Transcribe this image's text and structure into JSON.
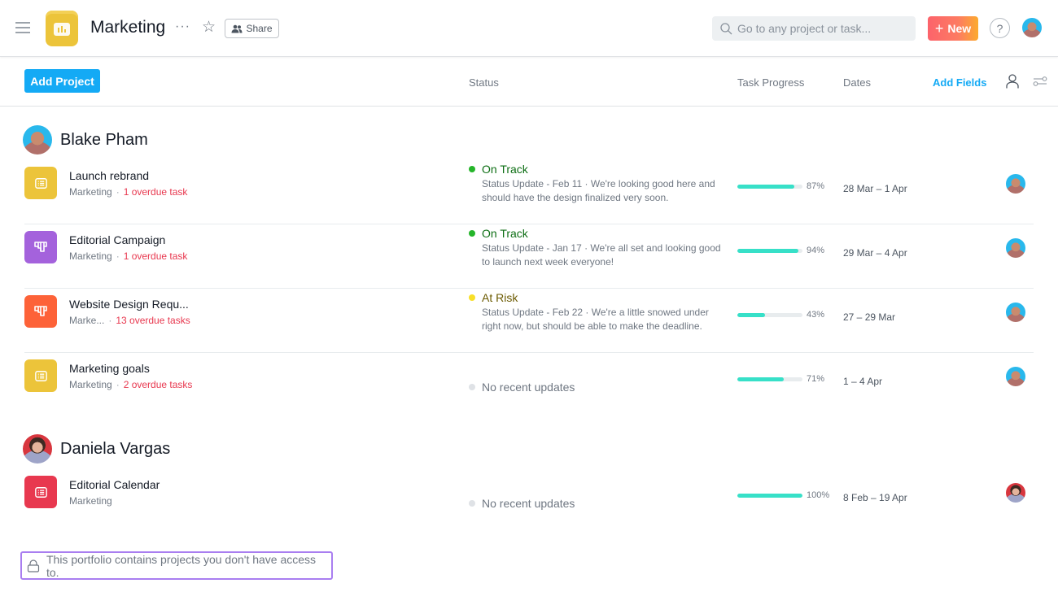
{
  "header": {
    "title": "Marketing",
    "more_label": "···",
    "share_label": "Share",
    "search_placeholder": "Go to any project or task...",
    "new_label": "New",
    "help_label": "?",
    "project_icon_color": "#ecc43a"
  },
  "toolbar": {
    "add_project_label": "Add Project",
    "columns": {
      "status": "Status",
      "task_progress": "Task Progress",
      "dates": "Dates"
    },
    "add_fields_label": "Add Fields"
  },
  "groups": [
    {
      "owner": "Blake Pham",
      "projects": [
        {
          "name": "Launch rebrand",
          "team": "Marketing",
          "overdue": "1 overdue task",
          "icon": "list-icon",
          "color": "#ecc43a",
          "status": "On Track",
          "status_color": "#25b52a",
          "status_text_color": "#0d6e14",
          "status_update": "Status Update - Feb 11 · We're looking good here and should have the design finalized very soon.",
          "progress": 87,
          "progress_label": "87%",
          "dates": "28 Mar – 1 Apr"
        },
        {
          "name": "Editorial Campaign",
          "team": "Marketing",
          "overdue": "1 overdue task",
          "icon": "board-icon",
          "color": "#a462dc",
          "status": "On Track",
          "status_color": "#25b52a",
          "status_text_color": "#0d6e14",
          "status_update": "Status Update - Jan 17 · We're all set and looking good to launch next week everyone!",
          "progress": 94,
          "progress_label": "94%",
          "dates": "29 Mar – 4 Apr"
        },
        {
          "name": "Website Design Requ...",
          "team": "Marke...",
          "overdue": "13 overdue tasks",
          "icon": "board-icon",
          "color": "#fd6238",
          "status": "At Risk",
          "status_color": "#f8df28",
          "status_text_color": "#6b5a00",
          "status_update": "Status Update - Feb 22 · We're a little snowed under right now, but should be able to make the deadline.",
          "progress": 43,
          "progress_label": "43%",
          "dates": "27 – 29 Mar"
        },
        {
          "name": "Marketing goals",
          "team": "Marketing",
          "overdue": "2 overdue tasks",
          "icon": "list-icon",
          "color": "#ecc43a",
          "status": "No recent updates",
          "status_color": "#dfe2e6",
          "progress": 71,
          "progress_label": "71%",
          "dates": "1 – 4 Apr"
        }
      ]
    },
    {
      "owner": "Daniela Vargas",
      "projects": [
        {
          "name": "Editorial Calendar",
          "team": "Marketing",
          "icon": "list-icon",
          "color": "#e8384f",
          "status": "No recent updates",
          "status_color": "#dfe2e6",
          "progress": 100,
          "progress_label": "100%",
          "dates": "8 Feb – 19 Apr"
        }
      ]
    }
  ],
  "notice": "This portfolio contains projects you don't have access to."
}
